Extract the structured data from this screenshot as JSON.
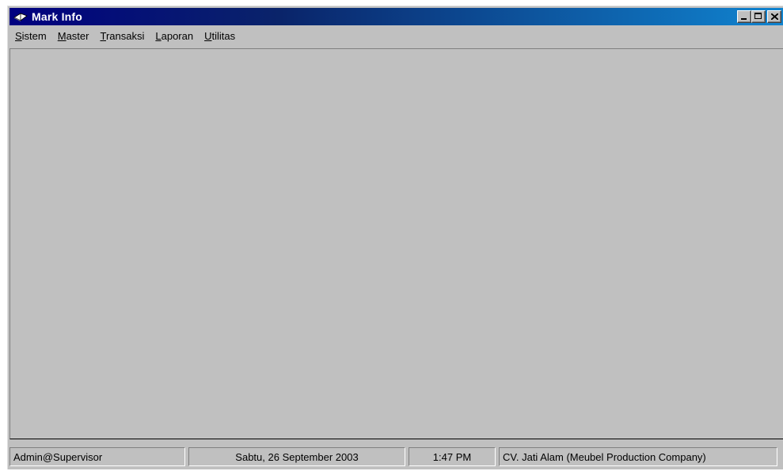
{
  "window": {
    "title": "Mark Info",
    "app_icon": "open-book-icon",
    "buttons": [
      "minimize-icon",
      "maximize-icon",
      "close-icon"
    ]
  },
  "menu": {
    "items": [
      {
        "accel": "S",
        "rest": "istem"
      },
      {
        "accel": "M",
        "rest": "aster"
      },
      {
        "accel": "T",
        "rest": "ransaksi"
      },
      {
        "accel": "L",
        "rest": "aporan"
      },
      {
        "accel": "U",
        "rest": "tilitas"
      }
    ]
  },
  "status": {
    "user": "Admin@Supervisor",
    "date": "Sabtu, 26 September 2003",
    "time": "1:47 PM",
    "company": "CV. Jati Alam (Meubel Production Company)"
  },
  "colors": {
    "title_gradient_start": "#000080",
    "title_gradient_end": "#1084d0",
    "face": "#c0c0c0"
  }
}
